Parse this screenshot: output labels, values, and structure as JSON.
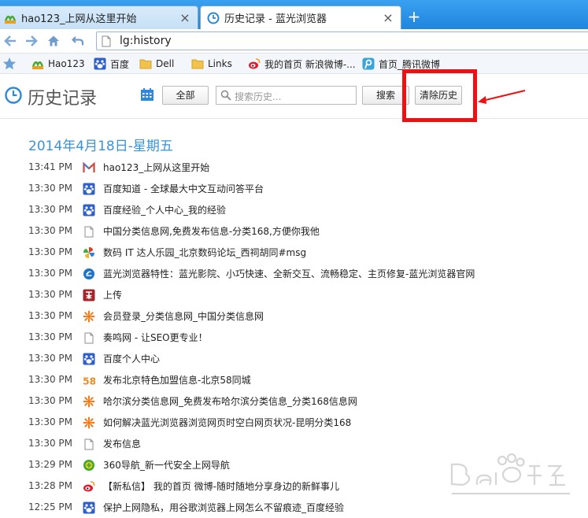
{
  "tabs": [
    {
      "title": "hao123_上网从这里开始",
      "icon": "hao123-icon"
    },
    {
      "title": "历史记录 - 蓝光浏览器",
      "icon": "clock-icon"
    }
  ],
  "new_tab_label": "+",
  "address": {
    "url": "lg:history"
  },
  "bookmarks": [
    {
      "label": "Hao123",
      "icon": "hao123-icon"
    },
    {
      "label": "百度",
      "icon": "baidu-paw-icon"
    },
    {
      "label": "Dell",
      "icon": "folder-icon"
    },
    {
      "label": "Links",
      "icon": "folder-icon"
    },
    {
      "label": "我的首页 新浪微博-...",
      "icon": "weibo-icon"
    },
    {
      "label": "首页_腾讯微博",
      "icon": "tencent-weibo-icon"
    }
  ],
  "header": {
    "title": "历史记录",
    "all_button": "全部",
    "search_placeholder": "搜索历史...",
    "search_button": "搜索",
    "clear_button": "清除历史"
  },
  "date_heading": "2014年4月18日-星期五",
  "history": [
    {
      "time": "13:41 PM",
      "title": "hao123_上网从这里开始",
      "icon": "gmail-m-icon"
    },
    {
      "time": "13:30 PM",
      "title": "百度知道 - 全球最大中文互动问答平台",
      "icon": "baidu-paw-icon"
    },
    {
      "time": "13:30 PM",
      "title": "百度经验_个人中心_我的经验",
      "icon": "baidu-paw-icon"
    },
    {
      "time": "13:30 PM",
      "title": "中国分类信息网,免费发布信息-分类168,方便你我他",
      "icon": "document-icon"
    },
    {
      "time": "13:30 PM",
      "title": "数码 IT 达人乐园_北京数码论坛_西祠胡同#msg",
      "icon": "pinwheel-icon"
    },
    {
      "time": "13:30 PM",
      "title": "蓝光浏览器特性：蓝光影院、小巧快速、全新交互、流畅稳定、主页修复-蓝光浏览器官网",
      "icon": "blue-browser-icon"
    },
    {
      "time": "13:30 PM",
      "title": "上传",
      "icon": "upload-site-icon"
    },
    {
      "time": "13:30 PM",
      "title": "会员登录_分类信息网_中国分类信息网",
      "icon": "orange-burst-icon"
    },
    {
      "time": "13:30 PM",
      "title": "奏鸣网 - 让SEO更专业！",
      "icon": "document-icon"
    },
    {
      "time": "13:30 PM",
      "title": "百度个人中心",
      "icon": "baidu-paw-icon"
    },
    {
      "time": "13:30 PM",
      "title": "发布北京特色加盟信息-北京58同城",
      "icon": "58-icon"
    },
    {
      "time": "13:30 PM",
      "title": "哈尔滨分类信息网_免费发布哈尔滨分类信息_分类168信息网",
      "icon": "orange-burst-icon"
    },
    {
      "time": "13:30 PM",
      "title": "如何解决蓝光浏览器浏览网页时空白网页状况-昆明分类168",
      "icon": "orange-burst-icon"
    },
    {
      "time": "13:30 PM",
      "title": "发布信息",
      "icon": "document-icon"
    },
    {
      "time": "13:29 PM",
      "title": "360导航_新一代安全上网导航",
      "icon": "360-icon"
    },
    {
      "time": "13:28 PM",
      "title": "【新私信】 我的首页 微博-随时随地分享身边的新鲜事儿",
      "icon": "weibo-icon"
    },
    {
      "time": "12:25 PM",
      "title": "保护上网隐私，用谷歌浏览器上网怎么不留痕迹_百度经验",
      "icon": "baidu-paw-icon"
    }
  ],
  "colors": {
    "accent": "#3a93d6",
    "annotation": "#ee1111",
    "tabbar": "#1f86de"
  }
}
